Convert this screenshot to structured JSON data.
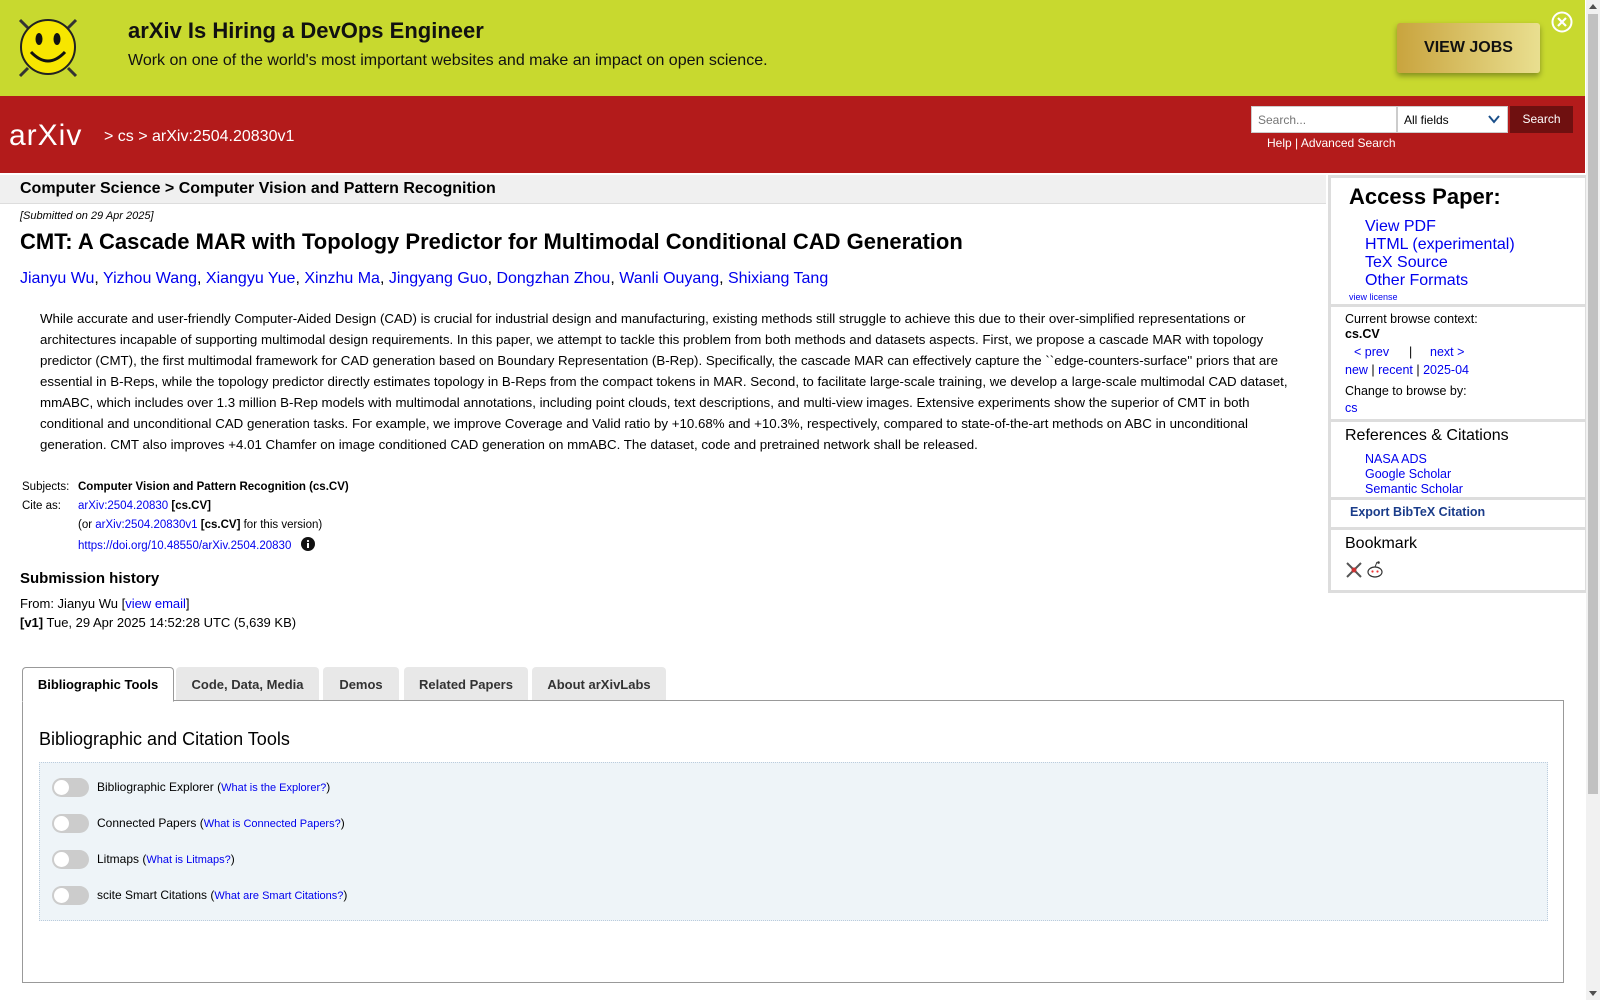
{
  "banner": {
    "title": "arXiv Is Hiring a DevOps Engineer",
    "text": "Work on one of the world's most important websites and make an impact on open science.",
    "button": "VIEW JOBS"
  },
  "header": {
    "logo": "arXiv",
    "crumbs": [
      "cs",
      "arXiv:2504.20830v1"
    ],
    "search_placeholder": "Search...",
    "search_field": "All fields",
    "search_button": "Search",
    "help": "Help",
    "advanced": "Advanced Search"
  },
  "subject_bar": "Computer Science > Computer Vision and Pattern Recognition",
  "paper": {
    "submitted": "[Submitted on 29 Apr 2025]",
    "title": "CMT: A Cascade MAR with Topology Predictor for Multimodal Conditional CAD Generation",
    "authors": [
      "Jianyu Wu",
      "Yizhou Wang",
      "Xiangyu Yue",
      "Xinzhu Ma",
      "Jingyang Guo",
      "Dongzhan Zhou",
      "Wanli Ouyang",
      "Shixiang Tang"
    ],
    "abstract": "While accurate and user-friendly Computer-Aided Design (CAD) is crucial for industrial design and manufacturing, existing methods still struggle to achieve this due to their over-simplified representations or architectures incapable of supporting multimodal design requirements. In this paper, we attempt to tackle this problem from both methods and datasets aspects. First, we propose a cascade MAR with topology predictor (CMT), the first multimodal framework for CAD generation based on Boundary Representation (B-Rep). Specifically, the cascade MAR can effectively capture the ``edge-counters-surface'' priors that are essential in B-Reps, while the topology predictor directly estimates topology in B-Reps from the compact tokens in MAR. Second, to facilitate large-scale training, we develop a large-scale multimodal CAD dataset, mmABC, which includes over 1.3 million B-Rep models with multimodal annotations, including point clouds, text descriptions, and multi-view images. Extensive experiments show the superior of CMT in both conditional and unconditional CAD generation tasks. For example, we improve Coverage and Valid ratio by +10.68% and +10.3%, respectively, compared to state-of-the-art methods on ABC in unconditional generation. CMT also improves +4.01 Chamfer on image conditioned CAD generation on mmABC. The dataset, code and pretrained network shall be released."
  },
  "meta": {
    "subjects_label": "Subjects:",
    "subjects": "Computer Vision and Pattern Recognition (cs.CV)",
    "cite_label": "Cite as:",
    "cite_id": "arXiv:2504.20830",
    "cite_cat": "[cs.CV]",
    "or_prefix": "(or",
    "version_id": "arXiv:2504.20830v1",
    "version_cat": "[cs.CV]",
    "version_suffix": "for this version)",
    "doi": "https://doi.org/10.48550/arXiv.2504.20830"
  },
  "history": {
    "title": "Submission history",
    "from_prefix": "From: Jianyu Wu [",
    "view_email": "view email",
    "from_suffix": "]",
    "v1_label": "[v1]",
    "v1_text": "Tue, 29 Apr 2025 14:52:28 UTC (5,639 KB)"
  },
  "sidebar": {
    "access_title": "Access Paper:",
    "access_links": [
      "View PDF",
      "HTML (experimental)",
      "TeX Source",
      "Other Formats"
    ],
    "view_license": "view license",
    "browse_label": "Current browse context:",
    "browse_context": "cs.CV",
    "prev": "< prev",
    "sep": "|",
    "next": "next >",
    "new": "new",
    "recent": "recent",
    "month": "2025-04",
    "change_label": "Change to browse by:",
    "change_cs": "cs",
    "refs_title": "References & Citations",
    "refs": [
      "NASA ADS",
      "Google Scholar",
      "Semantic Scholar"
    ],
    "export": "Export BibTeX Citation",
    "bookmark": "Bookmark"
  },
  "tabs": [
    "Bibliographic Tools",
    "Code, Data, Media",
    "Demos",
    "Related Papers",
    "About arXivLabs"
  ],
  "panel": {
    "title": "Bibliographic and Citation Tools",
    "rows": [
      {
        "label": "Bibliographic Explorer",
        "link": "What is the Explorer?"
      },
      {
        "label": "Connected Papers",
        "link": "What is Connected Papers?"
      },
      {
        "label": "Litmaps",
        "link": "What is Litmaps?"
      },
      {
        "label": "scite Smart Citations",
        "link": "What are Smart Citations?"
      }
    ]
  },
  "colors": {
    "header": "#b31b1b",
    "banner": "#c8d92f",
    "link": "#0000ee"
  }
}
